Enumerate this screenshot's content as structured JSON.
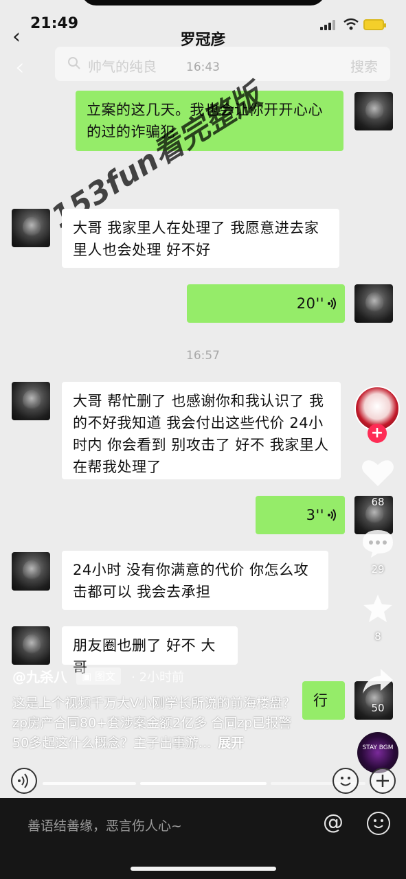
{
  "status_bar": {
    "time": "21:49"
  },
  "chat": {
    "title": "罗冠彦",
    "search": {
      "placeholder": "帅气的纯良",
      "button": "搜索"
    },
    "timestamps": [
      "16:43",
      "16:57"
    ],
    "messages": [
      {
        "side": "me",
        "text": "立案的这几天。我也会让你开开心心的过的诈骗犯"
      },
      {
        "side": "them",
        "text": "大哥 我家里人在处理了 我愿意进去家里人也会处理 好不好"
      },
      {
        "side": "me",
        "text": "20''",
        "type": "voice"
      },
      {
        "side": "them",
        "text": "大哥 帮忙删了 也感谢你和我认识了 我的不好我知道 我会付出这些代价 24小时内 你会看到 别攻击了 好不 我家里人 在帮我处理了"
      },
      {
        "side": "me",
        "text": "3''",
        "type": "voice"
      },
      {
        "side": "them",
        "text": "24小时 没有你满意的代价 你怎么攻击都可以 我会去承担"
      },
      {
        "side": "them",
        "text": "朋友圈也删了 好不 大哥"
      },
      {
        "side": "me",
        "text": "行"
      }
    ]
  },
  "watermark": "153fun看完整版",
  "video": {
    "author": "@九杀八",
    "tag": "图文",
    "post_time": "· 2小时前",
    "description": "这是上个视频千万大V小刚学长所说的前海楼盘？zp房产合同80+套涉案金额2亿多 合同zp已报警50多起这什么概念？主子出事游...",
    "expand_label": "展开",
    "likes": "68",
    "comments": "29",
    "favorites": "8",
    "shares": "50",
    "music_disc_text": "STAY BGM",
    "comment_placeholder": "善语结善缘，恶言伤人心~",
    "progress_segments": 3,
    "progress_active_index": 1
  },
  "colors": {
    "my_bubble": "#95ec69",
    "their_bubble": "#ffffff",
    "follow_plus": "#fe2c55",
    "comment_bar": "#161616"
  }
}
